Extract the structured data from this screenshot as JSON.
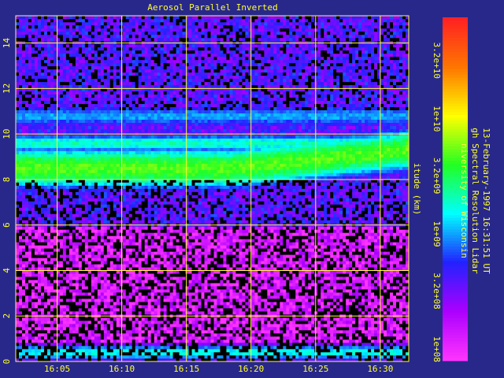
{
  "chart_data": {
    "type": "heatmap",
    "title": "Aerosol Parallel Inverted",
    "xlabel": "",
    "ylabel": "itude (km)",
    "x_ticks": [
      "16:05",
      "16:10",
      "16:15",
      "16:20",
      "16:25",
      "16:30"
    ],
    "x_tick_minutes": [
      5,
      10,
      15,
      20,
      25,
      30
    ],
    "xlim_minutes_after_1600": [
      1.8,
      32.2
    ],
    "y_ticks": [
      "0",
      "2",
      "4",
      "6",
      "8",
      "10",
      "12",
      "14"
    ],
    "y_tick_values": [
      0,
      2,
      4,
      6,
      8,
      10,
      12,
      14
    ],
    "ylim_km": [
      0,
      15.2
    ],
    "grid": true,
    "colorbar": {
      "ticks": [
        "1e+08",
        "3.2e+08",
        "1e+09",
        "3.2e+09",
        "1e+10",
        "3.2e+10"
      ],
      "log_min": 7.9,
      "log_max": 10.88,
      "colors": [
        "#ff33ff",
        "#aa00ff",
        "#2222ff",
        "#00ffff",
        "#22ff22",
        "#ffff00",
        "#ff7700",
        "#ff2222"
      ]
    },
    "layers": [
      {
        "altitude_km": 0.4,
        "thickness_km": 0.6,
        "log_backscatter": 9.2
      },
      {
        "altitude_km": 8.5,
        "thickness_km": 1.3,
        "log_backscatter": 9.7
      },
      {
        "altitude_km": 9.6,
        "thickness_km": 0.6,
        "log_backscatter": 9.3
      },
      {
        "altitude_km": 10.8,
        "thickness_km": 0.8,
        "log_backscatter": 9.0
      }
    ],
    "background_log_backscatter_low": 8.1,
    "background_log_backscatter_high": 8.6
  },
  "info": {
    "line1": "niversity of Wisconsin",
    "line2": "gh Spectral Resolution Lidar",
    "line3": "13-February-1997 16:31:51 UT"
  },
  "colors": {
    "axis": "#ffff33",
    "background": "#28288a"
  }
}
